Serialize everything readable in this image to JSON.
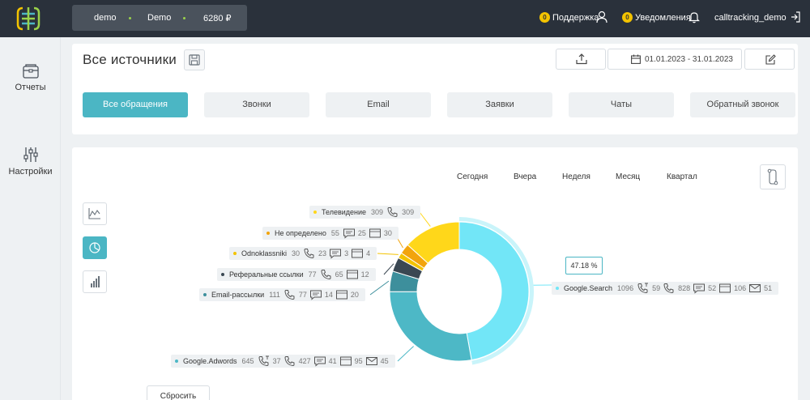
{
  "header": {
    "account_name": "demo",
    "account_label": "Demo",
    "balance": "6280 ₽",
    "support_count": "0",
    "support_label": "Поддержка",
    "notif_count": "0",
    "notif_label": "Уведомления",
    "username": "calltracking_demo"
  },
  "sidebar": {
    "items": [
      {
        "label": "Отчеты",
        "icon": "reports-icon"
      },
      {
        "label": "Настройки",
        "icon": "settings-sliders-icon"
      }
    ]
  },
  "page": {
    "title": "Все источники",
    "date_range": "01.01.2023 - 31.01.2023"
  },
  "tabs": [
    "Все обращения",
    "Звонки",
    "Email",
    "Заявки",
    "Чаты",
    "Обратный звонок"
  ],
  "periods": [
    "Сегодня",
    "Вчера",
    "Неделя",
    "Месяц",
    "Квартал"
  ],
  "reset_label": "Сбросить",
  "tooltip": "47.18 %",
  "colors": {
    "accent": "#4bb6c4",
    "topbar": "#2a313b",
    "badge": "#f3c300"
  },
  "chart_data": {
    "type": "pie",
    "variant": "donut",
    "slices": [
      {
        "name": "Google.Search",
        "value": 1096,
        "color": "#72e6f7",
        "calls_alt": "59",
        "calls": "828",
        "chats": "52",
        "requests": "106",
        "emails": "51"
      },
      {
        "name": "Google.Adwords",
        "value": 645,
        "color": "#4db8c6",
        "calls_alt": "37",
        "calls": "427",
        "chats": "41",
        "requests": "95",
        "emails": "45"
      },
      {
        "name": "Email-рассылки",
        "value": 111,
        "color": "#3d8f9c",
        "calls": "77",
        "chats": "14",
        "requests": "20"
      },
      {
        "name": "Реферальные ссылки",
        "value": 77,
        "color": "#3a4752",
        "calls": "65",
        "requests": "12"
      },
      {
        "name": "Odnoklassniki",
        "value": 30,
        "color": "#f3c300",
        "calls": "23",
        "chats": "3",
        "requests": "4"
      },
      {
        "name": "Не определено",
        "value": 55,
        "color": "#f2a40c",
        "chats": "25",
        "requests": "30"
      },
      {
        "name": "Телевидение",
        "value": 309,
        "color": "#ffd71a",
        "calls": "309"
      }
    ]
  }
}
